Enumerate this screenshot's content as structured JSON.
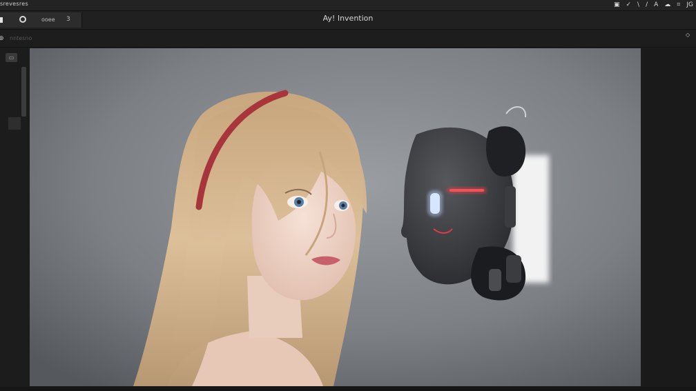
{
  "menubar": {
    "app_name": "srevesres",
    "icons": [
      "window-icon",
      "brush-icon",
      "line-icon",
      "pen-icon",
      "text-icon",
      "cloud-icon",
      "crop-icon",
      "layers-icon"
    ],
    "icon_glyphs": [
      "▣",
      "✓",
      "\\",
      "/",
      "A",
      "☁",
      "⌗",
      "JG"
    ]
  },
  "toolbar": {
    "tool_label": "ooee",
    "tool_value": "3"
  },
  "window": {
    "title": "Ay! Invention"
  },
  "subbar": {
    "label": "nntesno"
  },
  "colors": {
    "accent": "#e23a4a",
    "background": "#1b1b1c"
  }
}
